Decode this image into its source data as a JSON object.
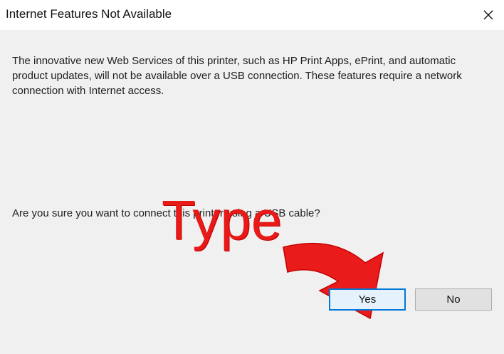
{
  "dialog": {
    "title": "Internet Features Not Available",
    "message": "The innovative new Web Services of this printer, such as HP Print Apps, ePrint, and automatic product updates, will not be available over a USB connection. These features require a network connection with Internet access.",
    "question": "Are you sure you want to connect this printer using a USB cable?",
    "buttons": {
      "yes": "Yes",
      "no": "No"
    },
    "icons": {
      "close": "close-icon"
    }
  },
  "annotation": {
    "text": "Type",
    "color": "#e81919"
  },
  "colors": {
    "accent": "#0078d7",
    "background": "#f0f0f0",
    "titlebar": "#ffffff"
  }
}
